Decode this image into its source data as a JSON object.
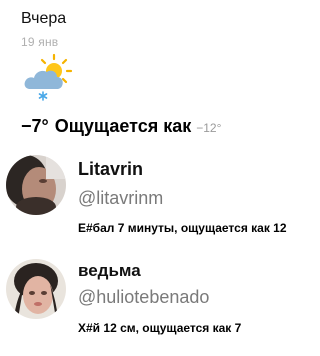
{
  "weather": {
    "day": "Вчера",
    "date": "19 янв",
    "condition_icon": "partly-cloudy-snow-icon",
    "temperature": "−7°",
    "feels_like_label": "Ощущается как",
    "feels_like_value": "−12°"
  },
  "tweets": [
    {
      "name": "Litavrin",
      "handle": "@litavrinm",
      "text": "Е#бал 7 минуты, ощущается как 12"
    },
    {
      "name": "ведьма",
      "handle": "@huliotebenado",
      "text": "Х#й 12 см, ощущается как 7"
    }
  ]
}
